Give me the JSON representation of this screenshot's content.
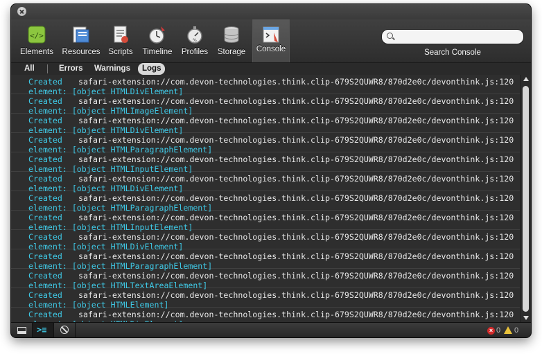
{
  "window": {
    "title": ""
  },
  "toolbar": {
    "items": [
      {
        "label": "Elements",
        "icon": "elements-icon"
      },
      {
        "label": "Resources",
        "icon": "resources-icon"
      },
      {
        "label": "Scripts",
        "icon": "scripts-icon"
      },
      {
        "label": "Timeline",
        "icon": "timeline-icon"
      },
      {
        "label": "Profiles",
        "icon": "profiles-icon"
      },
      {
        "label": "Storage",
        "icon": "storage-icon"
      },
      {
        "label": "Console",
        "icon": "console-icon",
        "active": true
      }
    ],
    "search": {
      "placeholder": "",
      "value": "",
      "label": "Search Console"
    }
  },
  "filters": {
    "all": "All",
    "errors": "Errors",
    "warnings": "Warnings",
    "logs": "Logs",
    "active": "Logs"
  },
  "console": {
    "messages": [
      {
        "created": "Created",
        "url": "safari-extension://com.devon-technologies.think.clip-679S2QUWR8/870d2e0c/devonthink.js:120",
        "prefix": "element:",
        "object": "[object HTMLDivElement]"
      },
      {
        "created": "Created",
        "url": "safari-extension://com.devon-technologies.think.clip-679S2QUWR8/870d2e0c/devonthink.js:120",
        "prefix": "element:",
        "object": "[object HTMLImageElement]"
      },
      {
        "created": "Created",
        "url": "safari-extension://com.devon-technologies.think.clip-679S2QUWR8/870d2e0c/devonthink.js:120",
        "prefix": "element:",
        "object": "[object HTMLDivElement]"
      },
      {
        "created": "Created",
        "url": "safari-extension://com.devon-technologies.think.clip-679S2QUWR8/870d2e0c/devonthink.js:120",
        "prefix": "element:",
        "object": "[object HTMLParagraphElement]"
      },
      {
        "created": "Created",
        "url": "safari-extension://com.devon-technologies.think.clip-679S2QUWR8/870d2e0c/devonthink.js:120",
        "prefix": "element:",
        "object": "[object HTMLInputElement]"
      },
      {
        "created": "Created",
        "url": "safari-extension://com.devon-technologies.think.clip-679S2QUWR8/870d2e0c/devonthink.js:120",
        "prefix": "element:",
        "object": "[object HTMLDivElement]"
      },
      {
        "created": "Created",
        "url": "safari-extension://com.devon-technologies.think.clip-679S2QUWR8/870d2e0c/devonthink.js:120",
        "prefix": "element:",
        "object": "[object HTMLParagraphElement]"
      },
      {
        "created": "Created",
        "url": "safari-extension://com.devon-technologies.think.clip-679S2QUWR8/870d2e0c/devonthink.js:120",
        "prefix": "element:",
        "object": "[object HTMLInputElement]"
      },
      {
        "created": "Created",
        "url": "safari-extension://com.devon-technologies.think.clip-679S2QUWR8/870d2e0c/devonthink.js:120",
        "prefix": "element:",
        "object": "[object HTMLDivElement]"
      },
      {
        "created": "Created",
        "url": "safari-extension://com.devon-technologies.think.clip-679S2QUWR8/870d2e0c/devonthink.js:120",
        "prefix": "element:",
        "object": "[object HTMLParagraphElement]"
      },
      {
        "created": "Created",
        "url": "safari-extension://com.devon-technologies.think.clip-679S2QUWR8/870d2e0c/devonthink.js:120",
        "prefix": "element:",
        "object": "[object HTMLTextAreaElement]"
      },
      {
        "created": "Created",
        "url": "safari-extension://com.devon-technologies.think.clip-679S2QUWR8/870d2e0c/devonthink.js:120",
        "prefix": "element:",
        "object": "[object HTMLElement]"
      },
      {
        "created": "Created",
        "url": "safari-extension://com.devon-technologies.think.clip-679S2QUWR8/870d2e0c/devonthink.js:120",
        "prefix": "element:",
        "object": "[object HTMLDivElement]"
      }
    ]
  },
  "status": {
    "error_count": "0",
    "warning_count": "0",
    "colors": {
      "error": "#d12a2a",
      "warning": "#e9c23b",
      "accent": "#3fc9e6"
    }
  }
}
